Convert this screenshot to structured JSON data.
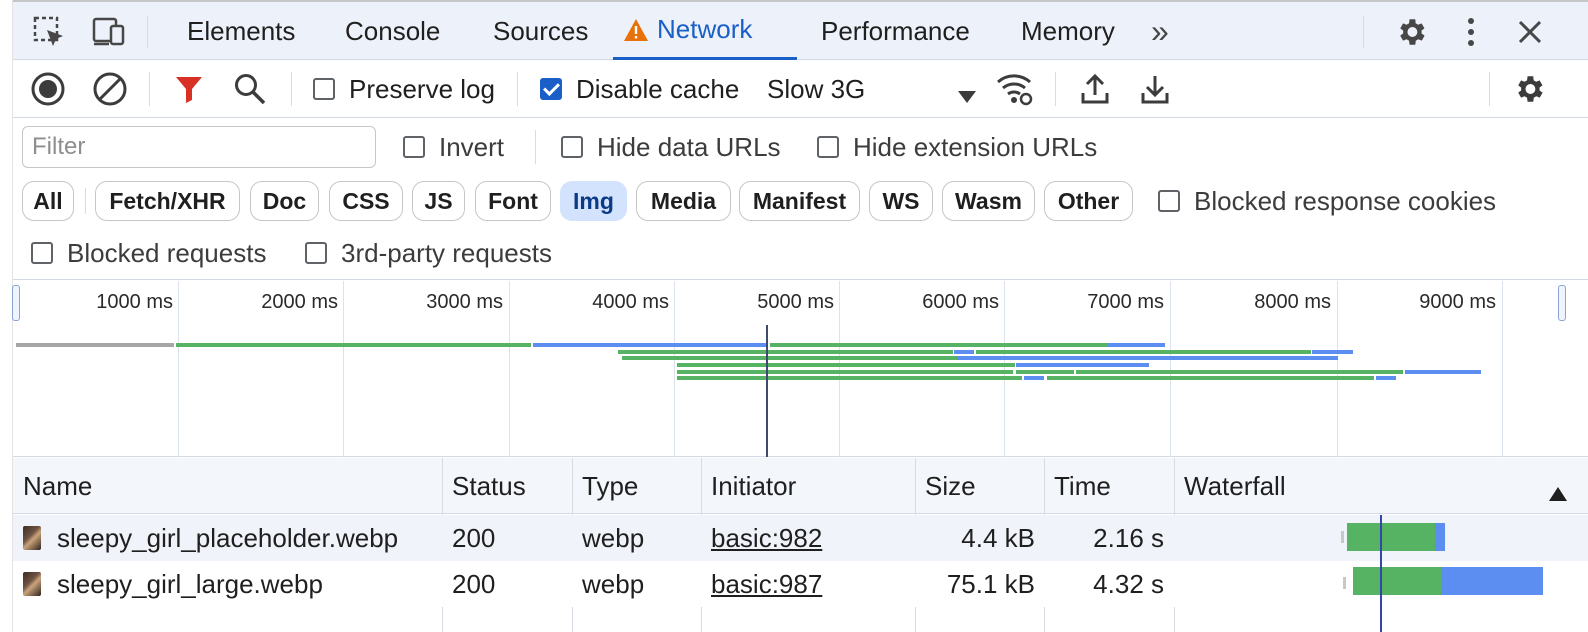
{
  "tabs_bar": {
    "tabs": [
      {
        "label": "Elements"
      },
      {
        "label": "Console"
      },
      {
        "label": "Sources"
      },
      {
        "label": "Network",
        "active": true,
        "warning": true
      },
      {
        "label": "Performance"
      },
      {
        "label": "Memory"
      }
    ],
    "more_label": "»",
    "icons": [
      "inspect-element-icon",
      "device-toolbar-icon",
      "settings-gear-icon",
      "kebab-menu-icon",
      "close-icon"
    ]
  },
  "toolbar": {
    "preserve_log": {
      "label": "Preserve log",
      "checked": false
    },
    "disable_cache": {
      "label": "Disable cache",
      "checked": true
    },
    "throttle": {
      "value": "Slow 3G"
    },
    "icons": [
      "record-icon",
      "clear-icon",
      "filter-icon",
      "search-icon",
      "network-conditions-icon",
      "import-har-icon",
      "export-har-icon",
      "network-settings-icon"
    ]
  },
  "filter": {
    "placeholder": "Filter",
    "invert": "Invert",
    "hide_data_urls": "Hide data URLs",
    "hide_extension_urls": "Hide extension URLs",
    "types": [
      "All",
      "Fetch/XHR",
      "Doc",
      "CSS",
      "JS",
      "Font",
      "Img",
      "Media",
      "Manifest",
      "WS",
      "Wasm",
      "Other"
    ],
    "active_type": "Img",
    "blocked_response_cookies": "Blocked response cookies",
    "blocked_requests": "Blocked requests",
    "third_party_requests": "3rd-party requests"
  },
  "overview": {
    "ticks": [
      "1000 ms",
      "2000 ms",
      "3000 ms",
      "4000 ms",
      "5000 ms",
      "6000 ms",
      "7000 ms",
      "8000 ms",
      "9000 ms"
    ]
  },
  "table": {
    "columns": [
      "Name",
      "Status",
      "Type",
      "Initiator",
      "Size",
      "Time",
      "Waterfall"
    ],
    "rows": [
      {
        "name": "sleepy_girl_placeholder.webp",
        "status": "200",
        "type": "webp",
        "initiator": "basic:982",
        "size": "4.4 kB",
        "time": "2.16 s"
      },
      {
        "name": "sleepy_girl_large.webp",
        "status": "200",
        "type": "webp",
        "initiator": "basic:987",
        "size": "75.1 kB",
        "time": "4.32 s"
      }
    ]
  },
  "colors": {
    "accent": "#1a5fc7",
    "waiting": "#55b363",
    "download": "#5b8ef0",
    "warning": "#e8710a"
  }
}
